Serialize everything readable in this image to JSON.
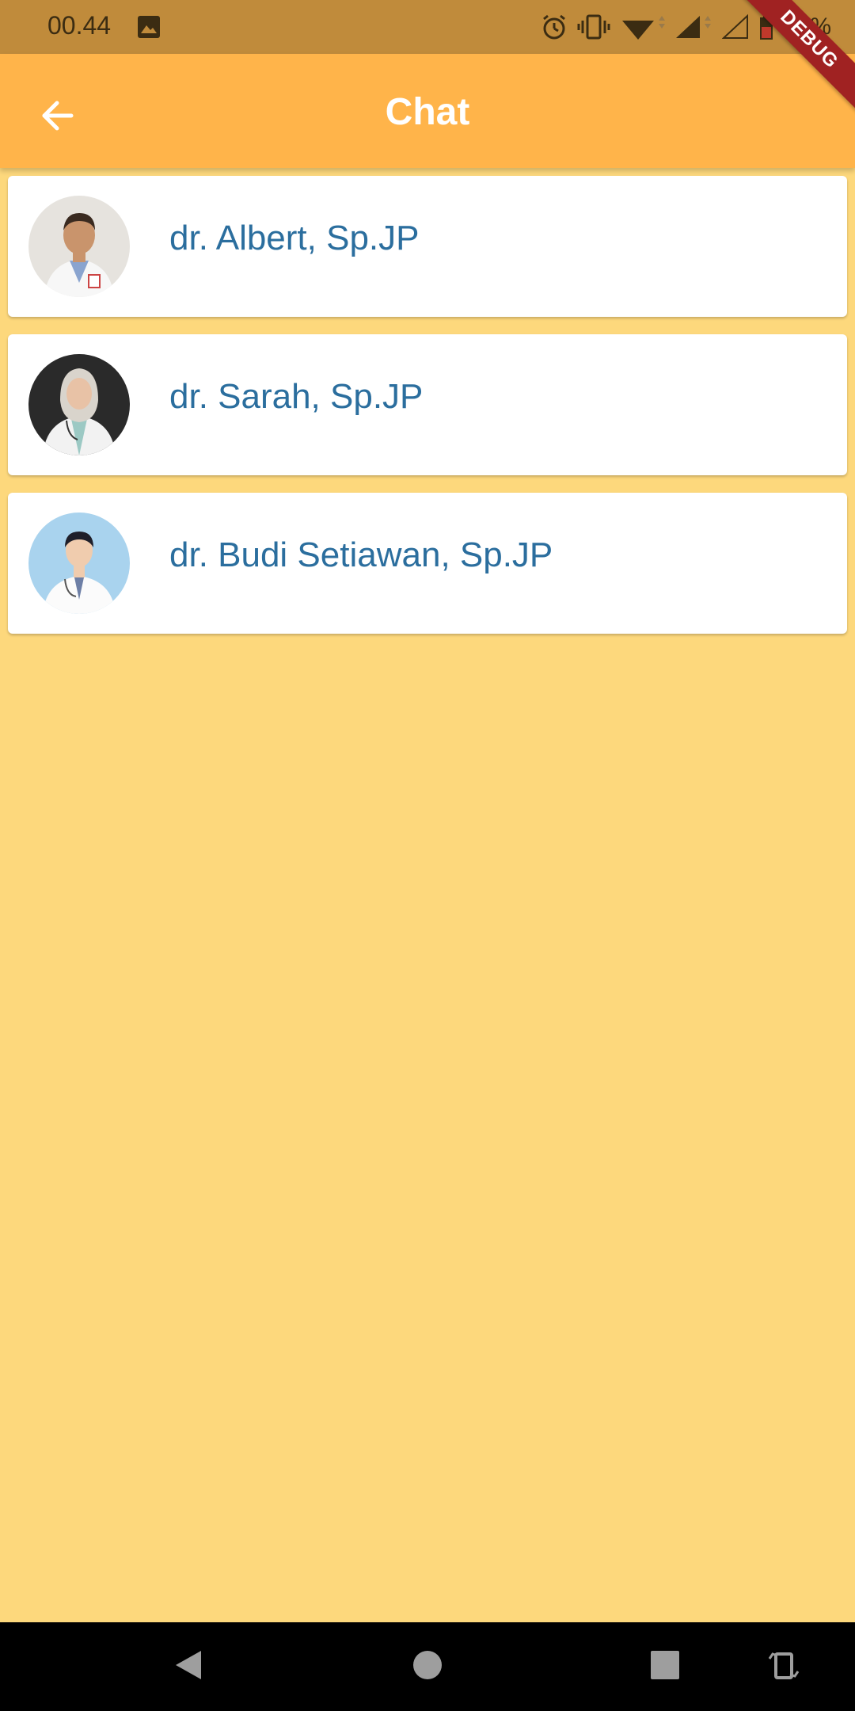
{
  "status_bar": {
    "time": "00.44",
    "battery": "64%"
  },
  "debug_banner": "DEBUG",
  "app_bar": {
    "title": "Chat",
    "color": "#ffb44a"
  },
  "background_color": "#fdd87c",
  "chats": [
    {
      "name": "dr. Albert, Sp.JP",
      "avatar_icon": "doctor-male-avatar"
    },
    {
      "name": "dr. Sarah, Sp.JP",
      "avatar_icon": "doctor-female-hijab-avatar"
    },
    {
      "name": "dr. Budi Setiawan, Sp.JP",
      "avatar_icon": "doctor-male-avatar"
    }
  ],
  "nav_bar": [
    "back-triangle-icon",
    "home-circle-icon",
    "recents-square-icon",
    "rotate-icon"
  ]
}
